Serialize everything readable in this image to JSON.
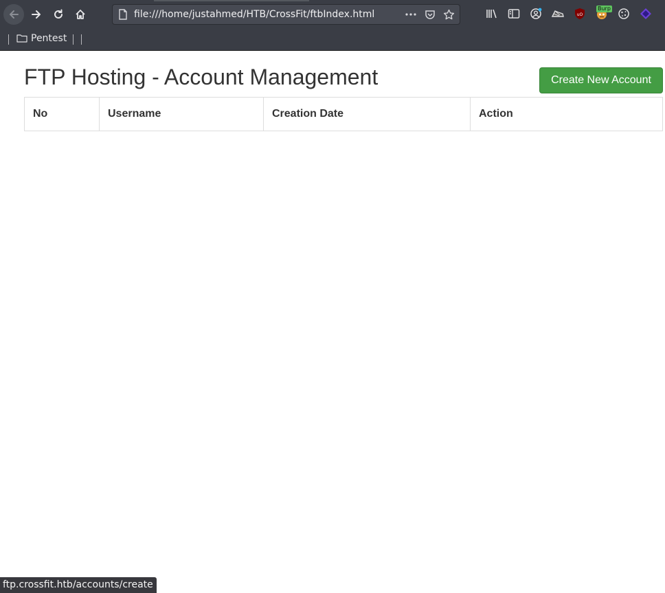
{
  "browser": {
    "url": "file:///home/justahmed/HTB/CrossFit/ftbIndex.html",
    "bookmarks": [
      {
        "label": "Pentest"
      }
    ],
    "extensions": {
      "burp_badge": "Burp"
    },
    "status_text": "ftp.crossfit.htb/accounts/create",
    "colors": {
      "chrome_bg": "#3a3d45",
      "url_bg": "#474a53"
    }
  },
  "page": {
    "title": "FTP Hosting - Account Management",
    "create_button_label": "Create New Account",
    "table": {
      "columns": [
        "No",
        "Username",
        "Creation Date",
        "Action"
      ],
      "rows": []
    },
    "colors": {
      "button_bg": "#449d44",
      "text": "#333333",
      "border": "#dddddd"
    }
  }
}
